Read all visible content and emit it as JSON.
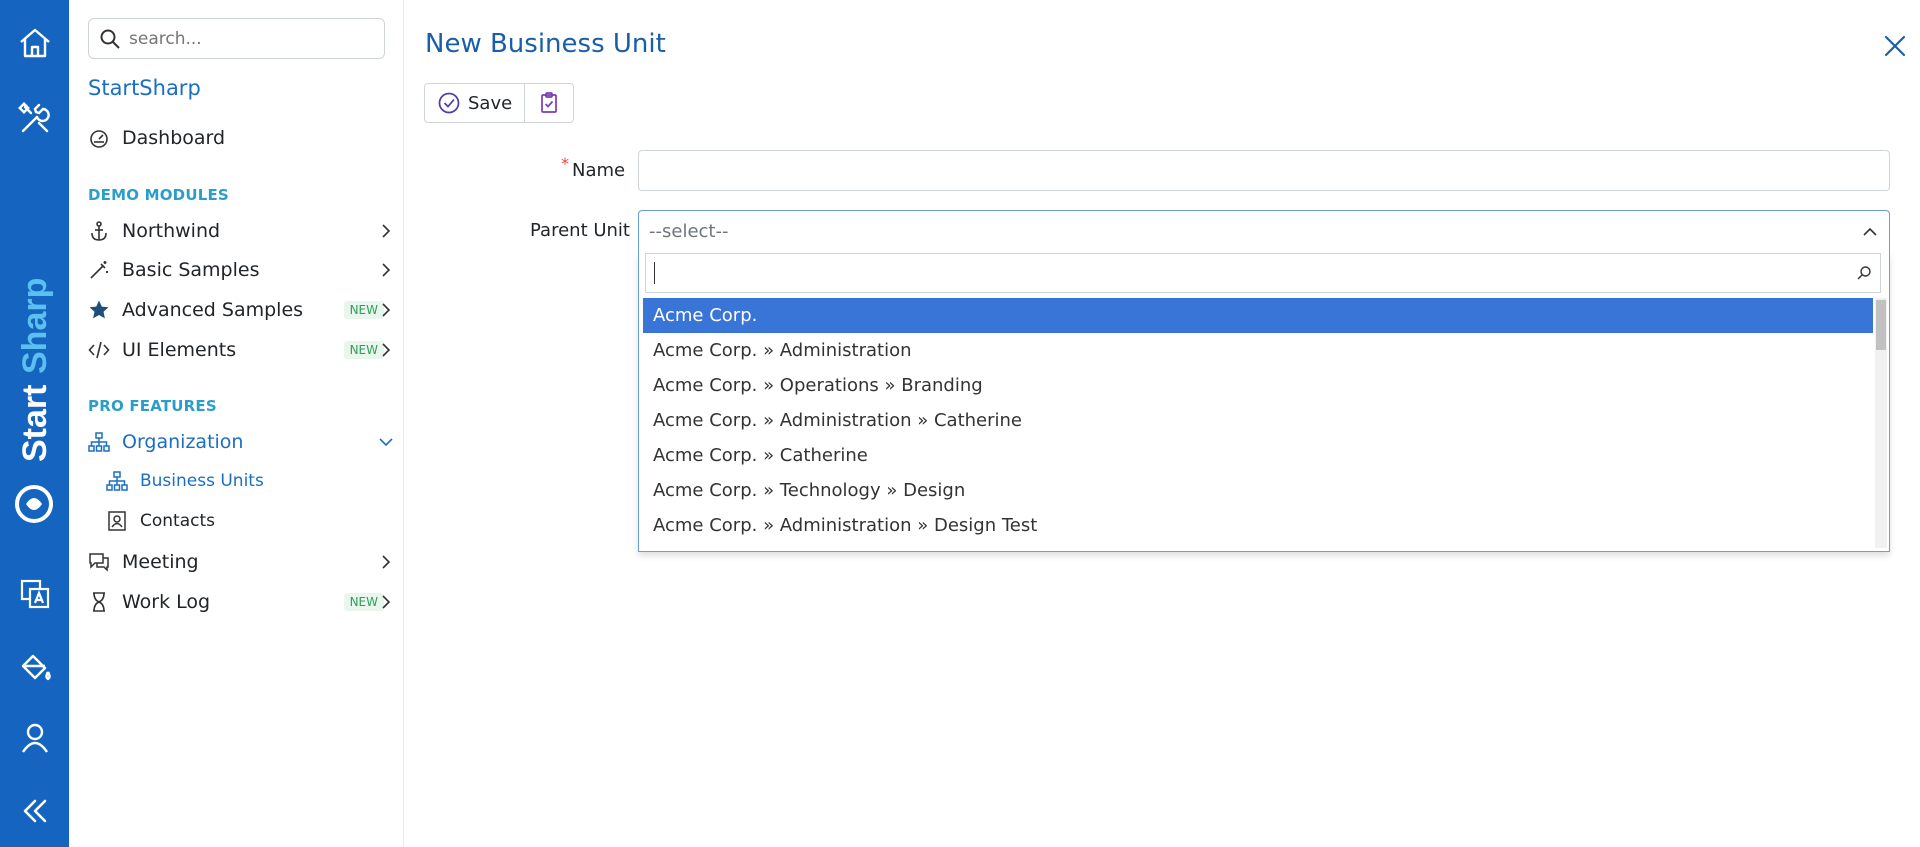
{
  "rail": {
    "brand_text_1": "Start",
    "brand_text_2": "Sharp"
  },
  "sidebar": {
    "search_placeholder": "search...",
    "app_title": "StartSharp",
    "dashboard": "Dashboard",
    "section_demo": "DEMO MODULES",
    "northwind": "Northwind",
    "basic_samples": "Basic Samples",
    "advanced_samples": "Advanced Samples",
    "ui_elements": "UI Elements",
    "new_badge": "NEW",
    "section_pro": "PRO FEATURES",
    "organization": "Organization",
    "business_units": "Business Units",
    "contacts": "Contacts",
    "meeting": "Meeting",
    "work_log": "Work Log"
  },
  "dialog": {
    "title": "New Business Unit",
    "save_label": "Save",
    "name_label": "Name",
    "required_mark": "*",
    "parent_label": "Parent Unit",
    "select_placeholder": "--select--",
    "options": [
      "Acme Corp.",
      "Acme Corp. » Administration",
      "Acme Corp. » Operations » Branding",
      "Acme Corp. » Administration » Catherine",
      "Acme Corp. » Catherine",
      "Acme Corp. » Technology » Design",
      "Acme Corp. » Administration » Design Test"
    ]
  },
  "colors": {
    "rail": "#1565c0",
    "accent": "#1b6fc2",
    "section": "#2a9ec9",
    "highlight": "#3875d7"
  }
}
